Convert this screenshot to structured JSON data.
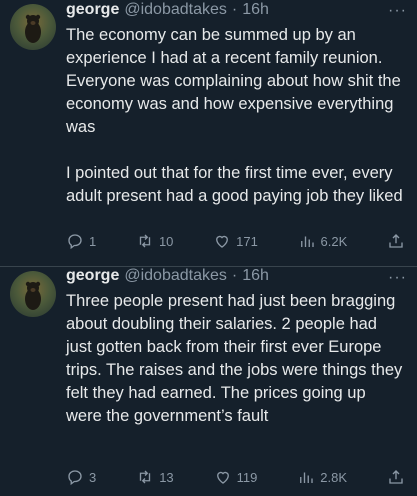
{
  "tweets": [
    {
      "name": "george",
      "handle": "@idobadtakes",
      "sep": "·",
      "time": "16h",
      "more": "···",
      "text": "The economy can be summed up by an experience I had at a recent family reunion. Everyone was complaining about how shit the economy was and how expensive everything was\n\nI pointed out that for the first time ever, every adult present had a good paying job they liked",
      "replies": "1",
      "retweets": "10",
      "likes": "171",
      "views": "6.2K"
    },
    {
      "name": "george",
      "handle": "@idobadtakes",
      "sep": "·",
      "time": "16h",
      "more": "···",
      "text": "Three people present had just been bragging about doubling their salaries. 2 people had just gotten back from their first ever Europe trips. The raises and the jobs were things they felt they had earned. The prices going up were the government’s fault",
      "replies": "3",
      "retweets": "13",
      "likes": "119",
      "views": "2.8K"
    }
  ],
  "icons": [
    "reply-icon",
    "retweet-icon",
    "like-icon",
    "views-icon",
    "share-icon"
  ],
  "colors": {
    "background": "#15202b",
    "text": "#e7e9ea",
    "muted": "#8b98a5",
    "divider": "#38444d"
  }
}
